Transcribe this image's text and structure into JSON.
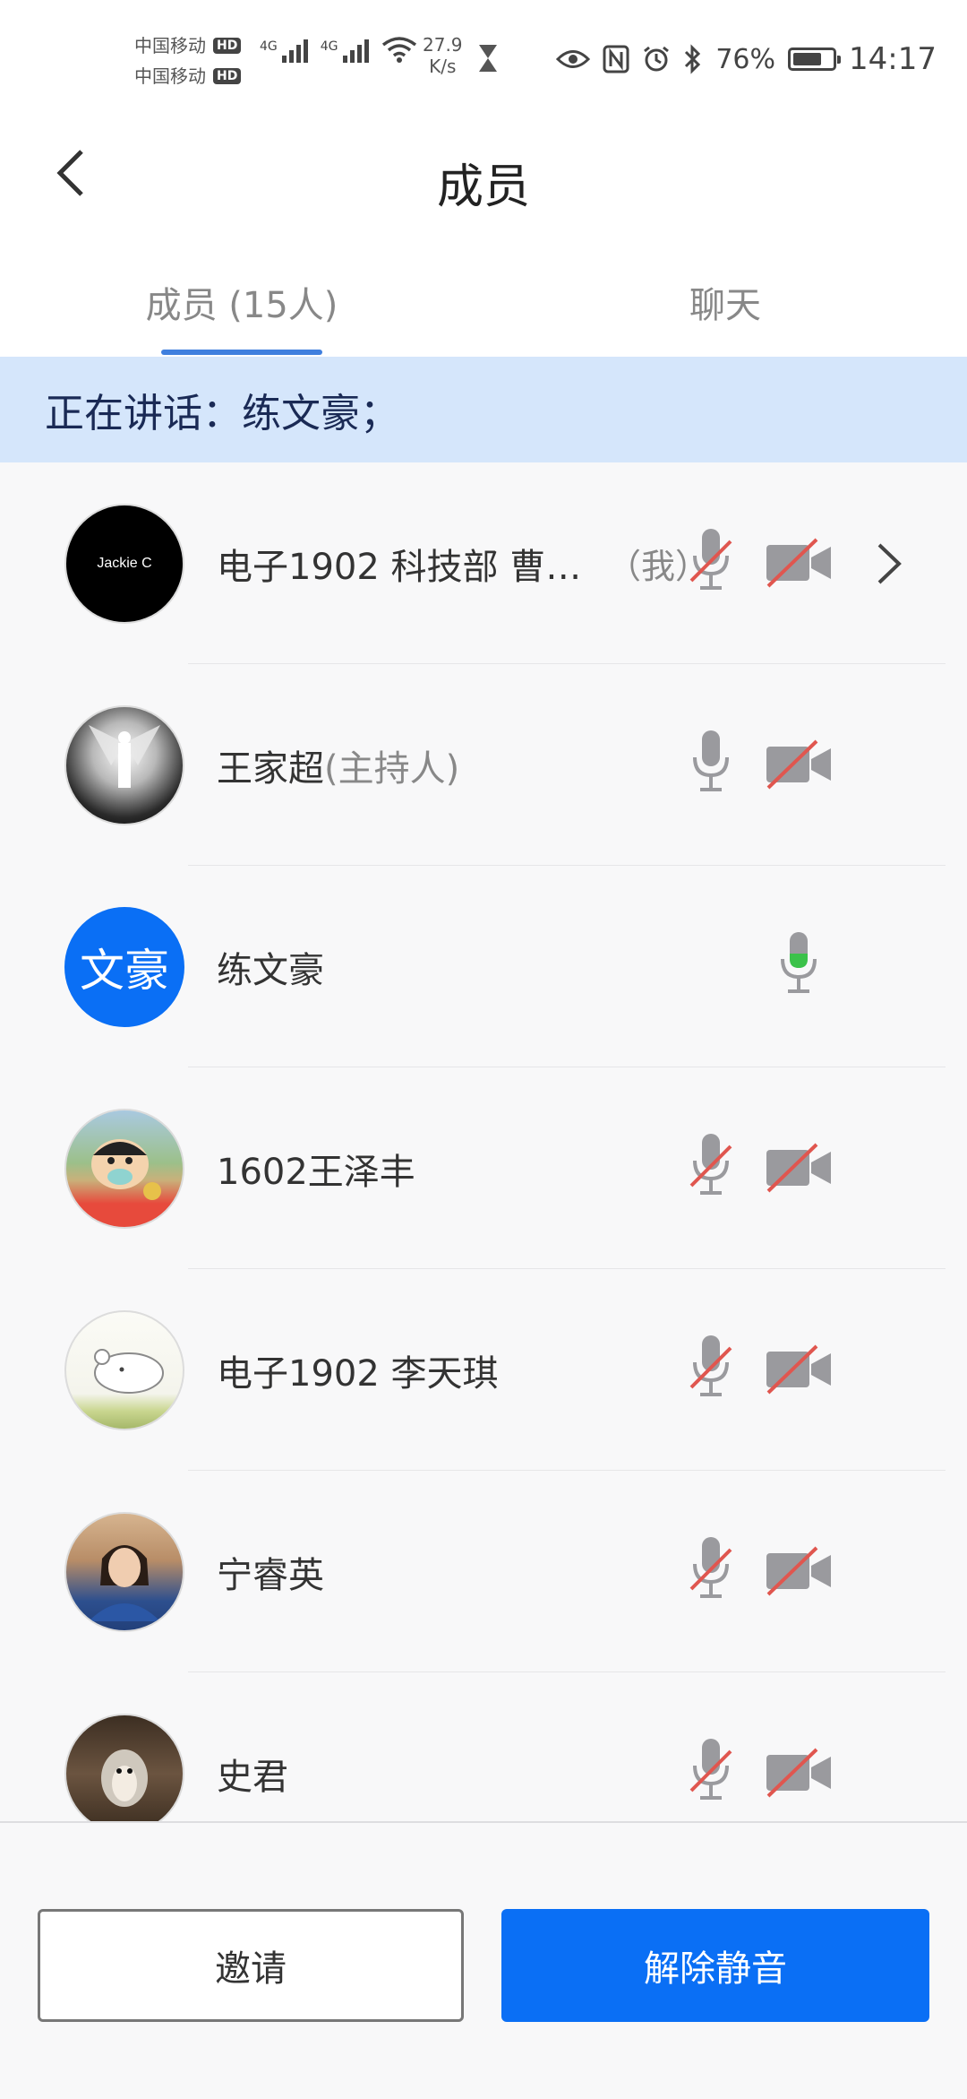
{
  "status_bar": {
    "carrier1": "中国移动",
    "carrier2": "中国移动",
    "hd_badge": "HD",
    "network_label": "4G",
    "speed_value": "27.9",
    "speed_unit": "K/s",
    "battery_percent": "76%",
    "battery_level": 0.76,
    "time": "14:17"
  },
  "header": {
    "title": "成员"
  },
  "tabs": [
    {
      "label": "成员 (15人)",
      "active": true
    },
    {
      "label": "聊天",
      "active": false
    }
  ],
  "banner": {
    "text": "正在讲话：练文豪；"
  },
  "members": [
    {
      "name": "电子1902 科技部 曹…",
      "role": "",
      "me_tag": "（我）",
      "avatar_text": "Jackie C",
      "mic": "muted",
      "camera": "off",
      "chevron": true
    },
    {
      "name": "王家超",
      "role": "(主持人)",
      "avatar_text": "",
      "mic": "on",
      "camera": "off"
    },
    {
      "name": "练文豪",
      "role": "",
      "avatar_text": "文豪",
      "mic": "speaking",
      "camera": "none"
    },
    {
      "name": "1602王泽丰",
      "role": "",
      "avatar_text": "",
      "mic": "muted",
      "camera": "off"
    },
    {
      "name": "电子1902 李天琪",
      "role": "",
      "avatar_text": "",
      "mic": "muted",
      "camera": "off"
    },
    {
      "name": "宁睿英",
      "role": "",
      "avatar_text": "",
      "mic": "muted",
      "camera": "off"
    },
    {
      "name": "史君",
      "role": "",
      "avatar_text": "",
      "mic": "muted",
      "camera": "off"
    }
  ],
  "footer": {
    "invite_label": "邀请",
    "unmute_label": "解除静音"
  },
  "colors": {
    "accent_blue": "#0a6ff5",
    "tab_indicator": "#3f7fde",
    "banner_bg": "#d5e6fb",
    "mute_red": "#e0564f",
    "speaking_green": "#3bc24a",
    "icon_gray": "#9a9a9e"
  }
}
